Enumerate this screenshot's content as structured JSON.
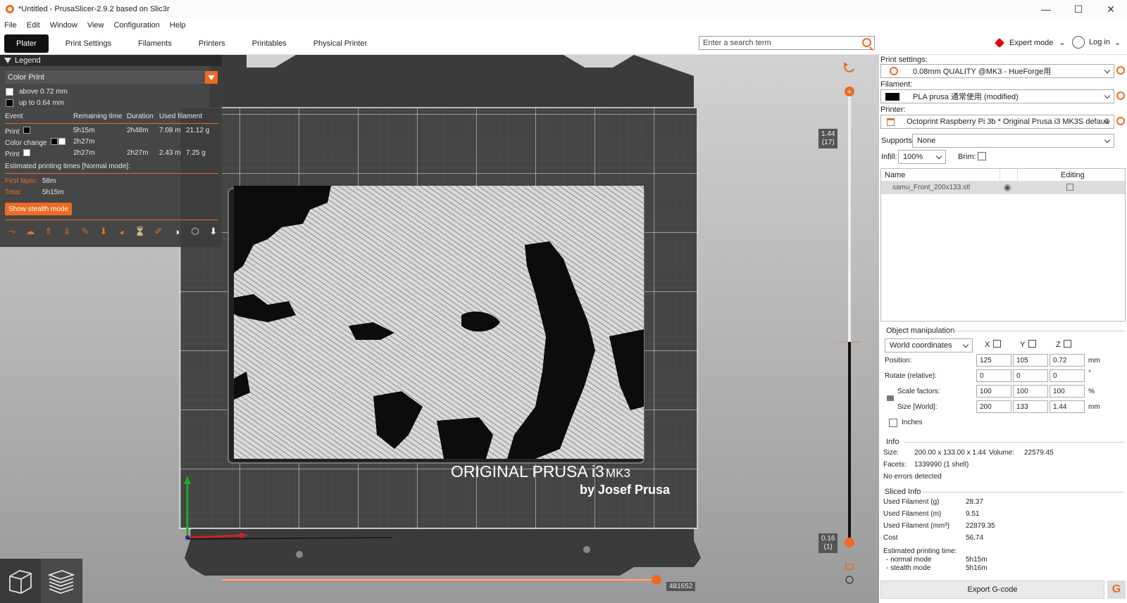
{
  "window": {
    "title": "*Untitled - PrusaSlicer-2.9.2 based on Slic3r",
    "controls": [
      "—",
      "☐",
      "✕"
    ]
  },
  "menu": [
    "File",
    "Edit",
    "Window",
    "View",
    "Configuration",
    "Help"
  ],
  "tabs": [
    "Plater",
    "Print Settings",
    "Filaments",
    "Printers",
    "Printables",
    "Physical Printer"
  ],
  "search": {
    "placeholder": "Enter a search term"
  },
  "mode": {
    "label": "Expert mode",
    "color": "#e60000"
  },
  "login": {
    "label": "Log in"
  },
  "legend": {
    "title": "Legend",
    "view_type": "Color Print",
    "ranges": [
      {
        "label": "above 0.72 mm",
        "color": "#ffffff"
      },
      {
        "label": "up to 0.64 mm",
        "color": "#000000"
      }
    ],
    "columns": [
      "Event",
      "Remaining time",
      "Duration",
      "Used filament"
    ],
    "events": [
      {
        "event": "Print",
        "remaining": "5h15m",
        "duration": "2h48m",
        "length": "7.08 m",
        "weight": "21.12 g"
      },
      {
        "event": "Color change",
        "remaining": "2h27m",
        "duration": "",
        "length": "",
        "weight": ""
      },
      {
        "event": "Print",
        "remaining": "2h27m",
        "duration": "2h27m",
        "length": "2.43 m",
        "weight": "7.25 g"
      }
    ],
    "estimated_title": "Estimated printing times [Normal mode]:",
    "first_layer_label": "First layer:",
    "first_layer_value": "58m",
    "total_label": "Total:",
    "total_value": "5h15m",
    "stealth_button": "Show stealth mode"
  },
  "bed": {
    "brand_line1": "ORIGINAL PRUSA i3",
    "brand_line1_small": "MK3",
    "brand_line2": "by Josef Prusa"
  },
  "layer_slider": {
    "top_value": "1.44",
    "top_layer": "(17)",
    "bottom_value": "0.16",
    "bottom_layer": "(1)"
  },
  "move_slider": {
    "value": "481652"
  },
  "right_panel": {
    "print_settings_label": "Print settings:",
    "print_settings_value": "0.08mm QUALITY @MK3 - HueForge用",
    "filament_label": "Filament:",
    "filament_value": "PLA prusa 通常使用 (modified)",
    "filament_color": "#000000",
    "printer_label": "Printer:",
    "printer_value": "Octoprint Raspberry Pi 3b * Original Prusa i3 MK3S default",
    "supports_label": "Supports:",
    "supports_value": "None",
    "infill_label": "Infill:",
    "infill_value": "100%",
    "brim_label": "Brim:",
    "list_name_header": "Name",
    "list_editing_header": "Editing",
    "object_name": "samu_Front_200x133.stl",
    "om_title": "Object manipulation",
    "coord_system": "World coordinates",
    "axes": [
      "X",
      "Y",
      "Z"
    ],
    "position_label": "Position:",
    "position": [
      "125",
      "105",
      "0.72"
    ],
    "position_unit": "mm",
    "rotate_label": "Rotate (relative):",
    "rotate": [
      "0",
      "0",
      "0"
    ],
    "rotate_unit": "°",
    "scale_label": "Scale factors:",
    "scale": [
      "100",
      "100",
      "100"
    ],
    "scale_unit": "%",
    "size_label": "Size [World]:",
    "size": [
      "200",
      "133",
      "1.44"
    ],
    "size_unit": "mm",
    "inches_label": "Inches",
    "info_title": "Info",
    "size_info_label": "Size:",
    "size_info_value": "200.00 x 133.00 x 1.44",
    "volume_label": "Volume:",
    "volume_value": "22579.45",
    "facets_label": "Facets:",
    "facets_value": "1339990 (1 shell)",
    "errors": "No errors detected",
    "sliced_title": "Sliced Info",
    "sliced": [
      {
        "label": "Used Filament (g)",
        "value": "28.37"
      },
      {
        "label": "Used Filament (m)",
        "value": "9.51"
      },
      {
        "label": "Used Filament (mm³)",
        "value": "22879.35"
      },
      {
        "label": "Cost",
        "value": "56.74"
      }
    ],
    "est_label": "Estimated printing time:",
    "normal_label": "- normal mode",
    "normal_value": "5h15m",
    "stealth_label": "- stealth mode",
    "stealth_value": "5h16m",
    "export_button": "Export G-code",
    "export_icon": "G"
  },
  "colors": {
    "accent": "#ed6b21"
  }
}
